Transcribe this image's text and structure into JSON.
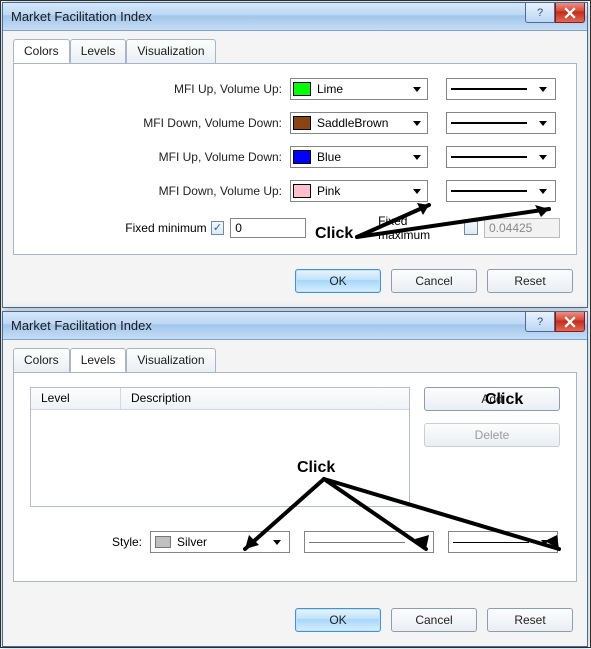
{
  "dialog1": {
    "title": "Market Facilitation Index",
    "tabs": {
      "colors": "Colors",
      "levels": "Levels",
      "visualization": "Visualization"
    },
    "rows": [
      {
        "label": "MFI Up, Volume Up:",
        "color_name": "Lime",
        "swatch": "#00ff00"
      },
      {
        "label": "MFI Down, Volume Down:",
        "color_name": "SaddleBrown",
        "swatch": "#8b4513"
      },
      {
        "label": "MFI Up, Volume Down:",
        "color_name": "Blue",
        "swatch": "#0000ff"
      },
      {
        "label": "MFI Down, Volume Up:",
        "color_name": "Pink",
        "swatch": "#ffc0cb"
      }
    ],
    "fixed_min_label": "Fixed minimum",
    "fixed_min_checked": true,
    "fixed_min_value": "0",
    "fixed_max_label": "Fixed maximum",
    "fixed_max_checked": false,
    "fixed_max_value": "0.04425",
    "buttons": {
      "ok": "OK",
      "cancel": "Cancel",
      "reset": "Reset"
    }
  },
  "dialog2": {
    "title": "Market Facilitation Index",
    "tabs": {
      "colors": "Colors",
      "levels": "Levels",
      "visualization": "Visualization"
    },
    "columns": {
      "level": "Level",
      "description": "Description"
    },
    "buttons": {
      "add": "Add",
      "delete": "Delete",
      "ok": "OK",
      "cancel": "Cancel",
      "reset": "Reset"
    },
    "style_label": "Style:",
    "style_color_name": "Silver",
    "style_swatch": "#c0c0c0"
  },
  "annotations": {
    "click_top": "Click",
    "click_bottom_left": "Click",
    "click_bottom_right": "Click"
  }
}
